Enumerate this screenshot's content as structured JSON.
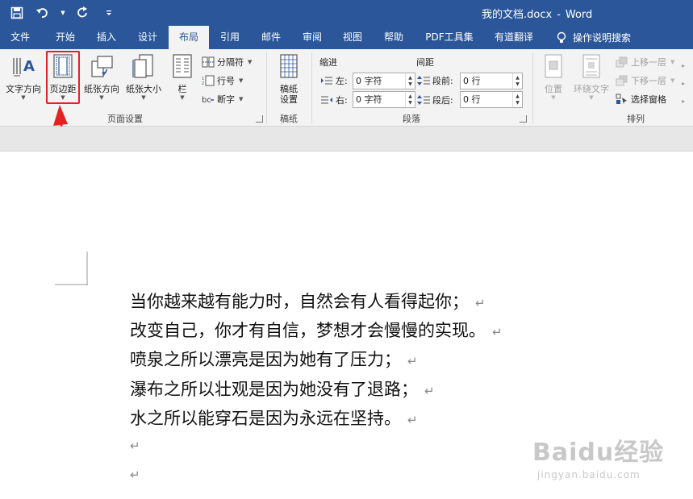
{
  "window": {
    "document_name": "我的文档.docx",
    "separator": "-",
    "app_name": "Word"
  },
  "quick_access": {
    "save_icon": "save-icon",
    "undo_icon": "undo-icon",
    "redo_icon": "redo-icon",
    "customize_icon": "customize-qat-icon"
  },
  "tabs": [
    {
      "label": "文件",
      "active": false
    },
    {
      "label": "开始",
      "active": false
    },
    {
      "label": "插入",
      "active": false
    },
    {
      "label": "设计",
      "active": false
    },
    {
      "label": "布局",
      "active": true
    },
    {
      "label": "引用",
      "active": false
    },
    {
      "label": "邮件",
      "active": false
    },
    {
      "label": "审阅",
      "active": false
    },
    {
      "label": "视图",
      "active": false
    },
    {
      "label": "帮助",
      "active": false
    },
    {
      "label": "PDF工具集",
      "active": false
    },
    {
      "label": "有道翻译",
      "active": false
    }
  ],
  "tell_me": {
    "label": "操作说明搜索"
  },
  "ribbon": {
    "page_setup": {
      "label": "页面设置",
      "text_direction": "文字方向",
      "margins": "页边距",
      "orientation": "纸张方向",
      "size": "纸张大小",
      "columns": "栏",
      "breaks": "分隔符",
      "line_numbers": "行号",
      "hyphenation": "断字"
    },
    "manuscript": {
      "label": "稿纸",
      "button_line1": "稿纸",
      "button_line2": "设置"
    },
    "paragraph": {
      "label": "段落",
      "indent_header": "缩进",
      "spacing_header": "间距",
      "left_label": "左:",
      "left_value": "0 字符",
      "right_label": "右:",
      "right_value": "0 字符",
      "before_label": "段前:",
      "before_value": "0 行",
      "after_label": "段后:",
      "after_value": "0 行"
    },
    "arrange": {
      "label": "排列",
      "position": "位置",
      "wrap_text": "环绕文字",
      "bring_forward": "上移一层",
      "send_backward": "下移一层",
      "selection_pane": "选择窗格"
    }
  },
  "document": {
    "paragraphs": [
      "当你越来越有能力时，自然会有人看得起你；",
      "改变自己，你才有自信，梦想才会慢慢的实现。",
      "喷泉之所以漂亮是因为她有了压力；",
      "瀑布之所以壮观是因为她没有了退路；",
      "水之所以能穿石是因为永远在坚持。"
    ],
    "paragraph_mark": "↵"
  },
  "watermark": {
    "brand": "Baidu经验",
    "url": "jingyan.baidu.com"
  },
  "colors": {
    "title_bar": "#2b579a",
    "ribbon": "#f3f3f3",
    "highlight": "#e52222"
  }
}
